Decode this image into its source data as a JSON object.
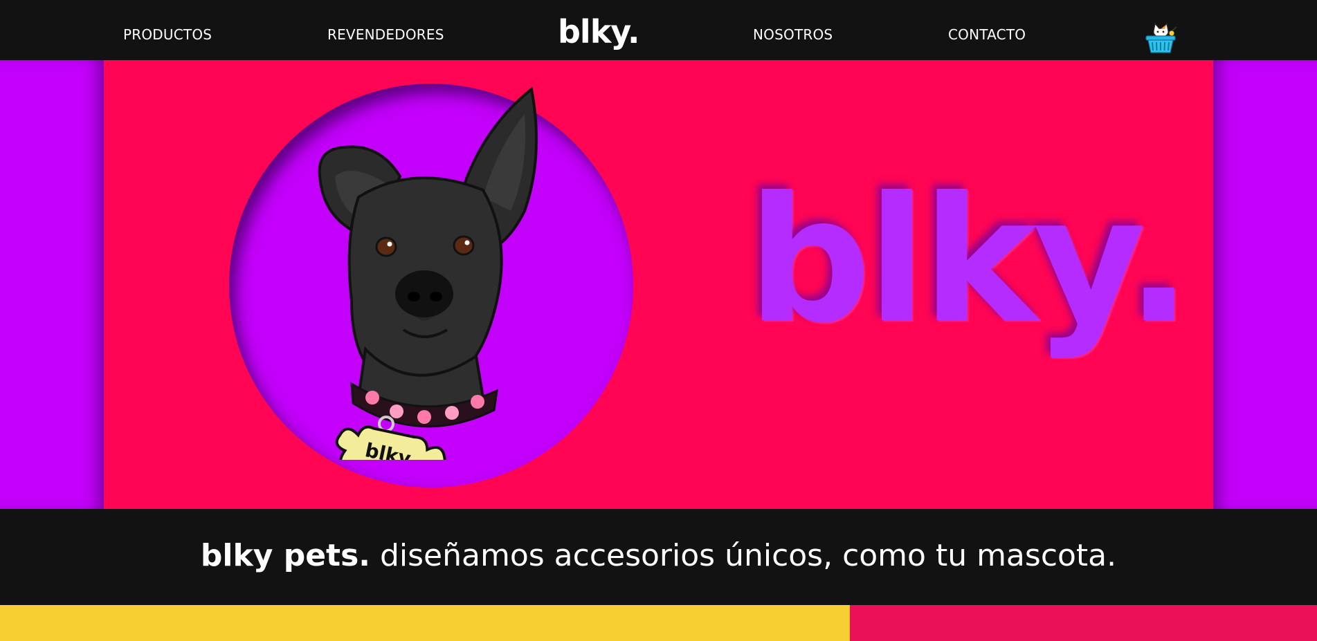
{
  "nav": {
    "products": "PRODUCTOS",
    "resellers": "REVENDEDORES",
    "logo": "blky.",
    "about": "NOSOTROS",
    "contact": "CONTACTO",
    "cart_icon": "shopping-basket-with-cat-icon"
  },
  "hero": {
    "dog_tag_text": "blky.",
    "wordmark": "blky.",
    "colors": {
      "background": "#ff0553",
      "circle": "#c300fa",
      "sides": "#c300fa",
      "wordmark": "#b42cff"
    }
  },
  "tagline": {
    "brand": "blky pets.",
    "text": " diseñamos accesorios únicos, como tu mascota."
  },
  "colors": {
    "nav_background": "#121212",
    "panel_yellow": "#f7cf33",
    "panel_pink": "#eb1158"
  }
}
